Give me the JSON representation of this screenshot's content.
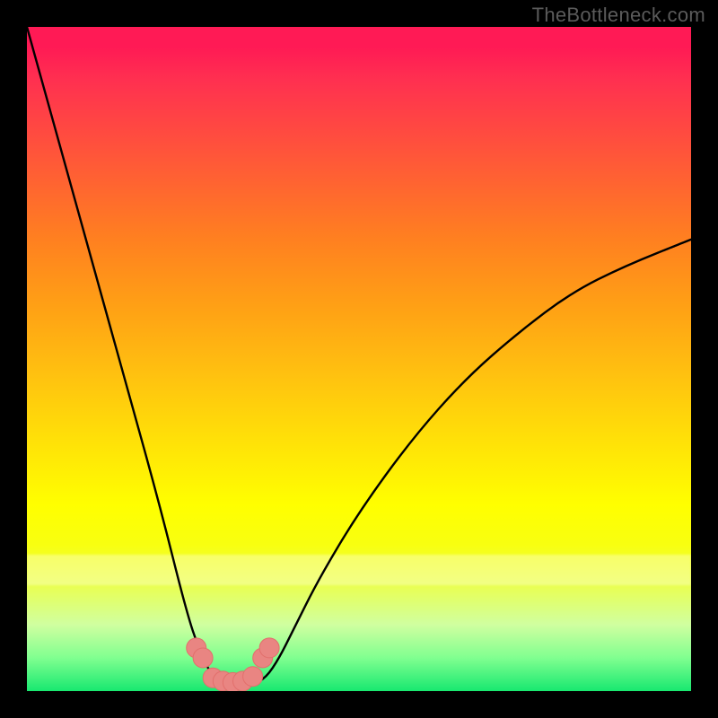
{
  "watermark": "TheBottleneck.com",
  "colors": {
    "background": "#000000",
    "gradient_top": "#ff1a55",
    "gradient_mid": "#ffff00",
    "gradient_bottom": "#18e870",
    "curve_stroke": "#000000",
    "marker_fill": "#e98582",
    "marker_stroke": "#e26f6c"
  },
  "chart_data": {
    "type": "line",
    "title": "",
    "xlabel": "",
    "ylabel": "",
    "xlim": [
      0,
      100
    ],
    "ylim": [
      0,
      100
    ],
    "grid": false,
    "legend": false,
    "series": [
      {
        "name": "bottleneck-curve",
        "x": [
          0,
          5,
          10,
          15,
          20,
          24,
          26,
          28,
          30,
          32,
          34,
          36,
          38,
          40,
          44,
          50,
          58,
          66,
          74,
          82,
          90,
          100
        ],
        "values": [
          100,
          82,
          64,
          46,
          28,
          12,
          6,
          2,
          1,
          1,
          1,
          2,
          5,
          9,
          17,
          27,
          38,
          47,
          54,
          60,
          64,
          68
        ]
      }
    ],
    "markers": {
      "name": "highlighted-points",
      "style": "overlapping-circles",
      "x": [
        25.5,
        26.5,
        28.0,
        29.5,
        31.0,
        32.5,
        34.0,
        35.5,
        36.5
      ],
      "values": [
        6.5,
        5.0,
        2.0,
        1.5,
        1.3,
        1.5,
        2.2,
        5.0,
        6.5
      ]
    }
  }
}
